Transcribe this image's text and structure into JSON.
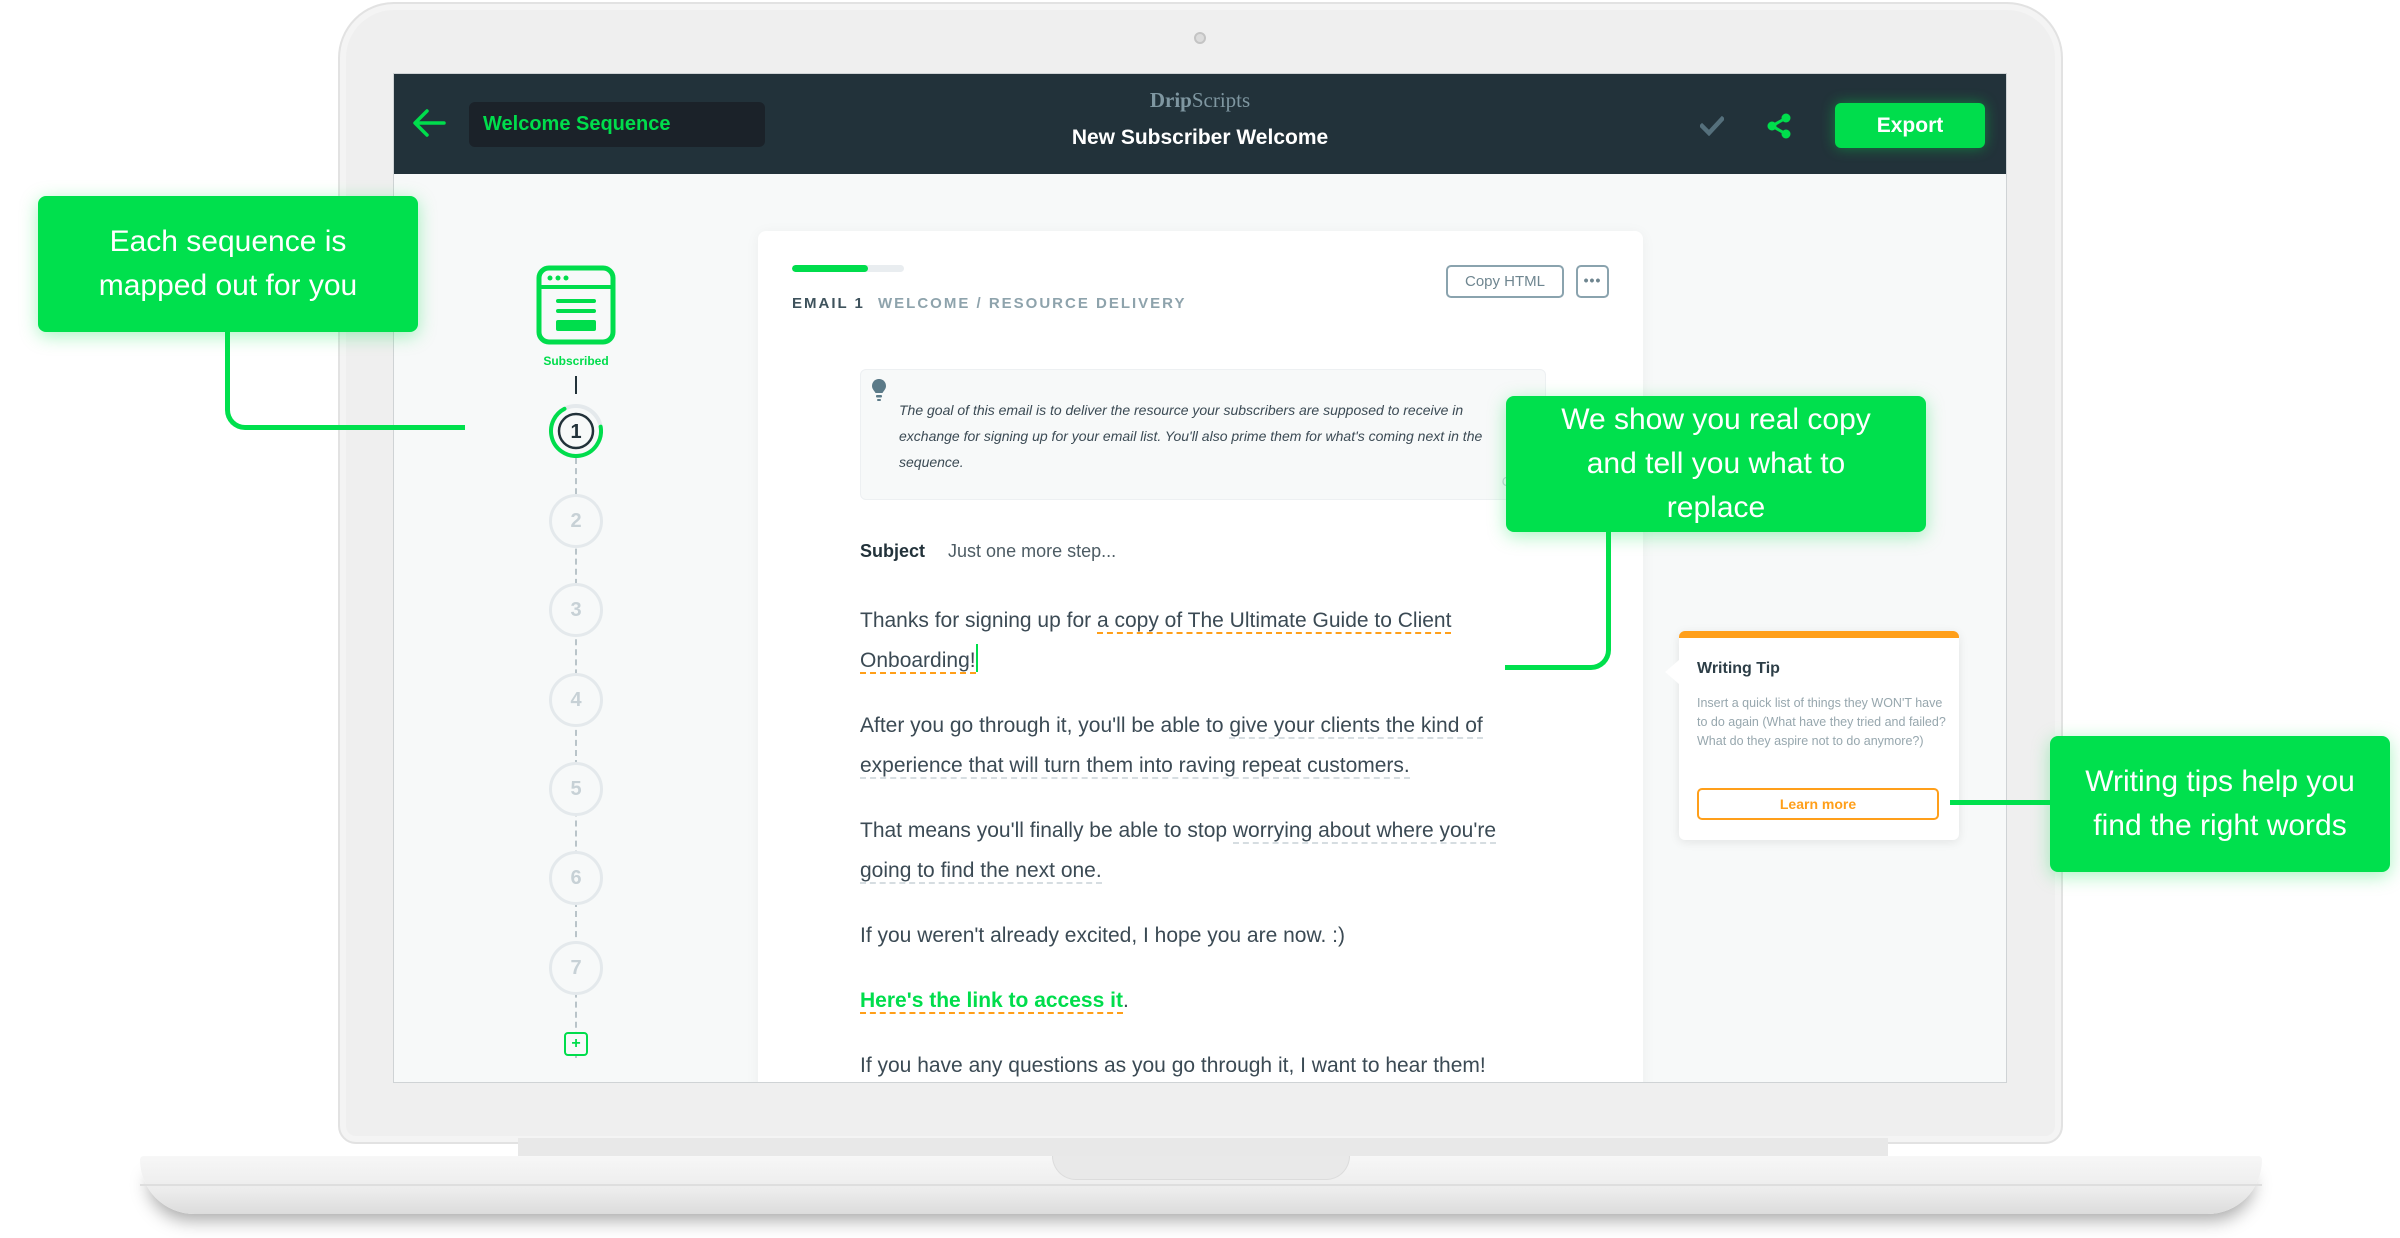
{
  "header": {
    "back_label": "Back",
    "sequence_name": "Welcome Sequence",
    "brand_bold": "Drip",
    "brand_light": "Scripts",
    "title": "New Subscriber Welcome",
    "export_label": "Export"
  },
  "timeline": {
    "start_label": "Subscribed",
    "steps": [
      "1",
      "2",
      "3",
      "4",
      "5",
      "6",
      "7"
    ],
    "active_step": "1",
    "add_label": "+"
  },
  "email": {
    "progress_percent": 68,
    "number_label": "EMAIL 1",
    "type_label": "WELCOME / RESOURCE DELIVERY",
    "copy_html_label": "Copy HTML",
    "more_label": "•••",
    "goal_text": "The goal of this email is to deliver the resource your subscribers are supposed to receive in exchange for signing up for your email list. You'll also prime them for what's coming next in the sequence.",
    "goal_close_label": "Close",
    "subject_label": "Subject",
    "subject_value": "Just one more step...",
    "paragraphs": {
      "p1_start": "Thanks for signing up for ",
      "p1_replace": "a copy of The Ultimate Guide to Client Onboarding!",
      "p2_start": "After you go through it, you'll be able to ",
      "p2_hint": "give your clients the kind of experience that will turn them into raving repeat customers.",
      "p3_start": "That means you'll finally be able to stop ",
      "p3_hint": "worrying about where you're going to find the next one.",
      "p4": "If you weren't already excited, I hope you are now. :)",
      "p5_link": "Here's the link to access it",
      "p5_end": ".",
      "p6": "If you have any questions as you go through it, I want to hear them!"
    }
  },
  "writing_tip": {
    "title": "Writing Tip",
    "text": "Insert a quick list of things they WON'T have to do again (What have they tried and failed? What do they aspire not to do anymore?)",
    "button_label": "Learn more"
  },
  "callouts": {
    "sequence": "Each sequence is mapped out for you",
    "copy": "We show you real copy and tell you what to replace",
    "tips": "Writing tips help you find the right words"
  },
  "colors": {
    "accent_green": "#00dd4c",
    "header_bg": "#22323a",
    "tip_orange": "#ff9f1a"
  }
}
